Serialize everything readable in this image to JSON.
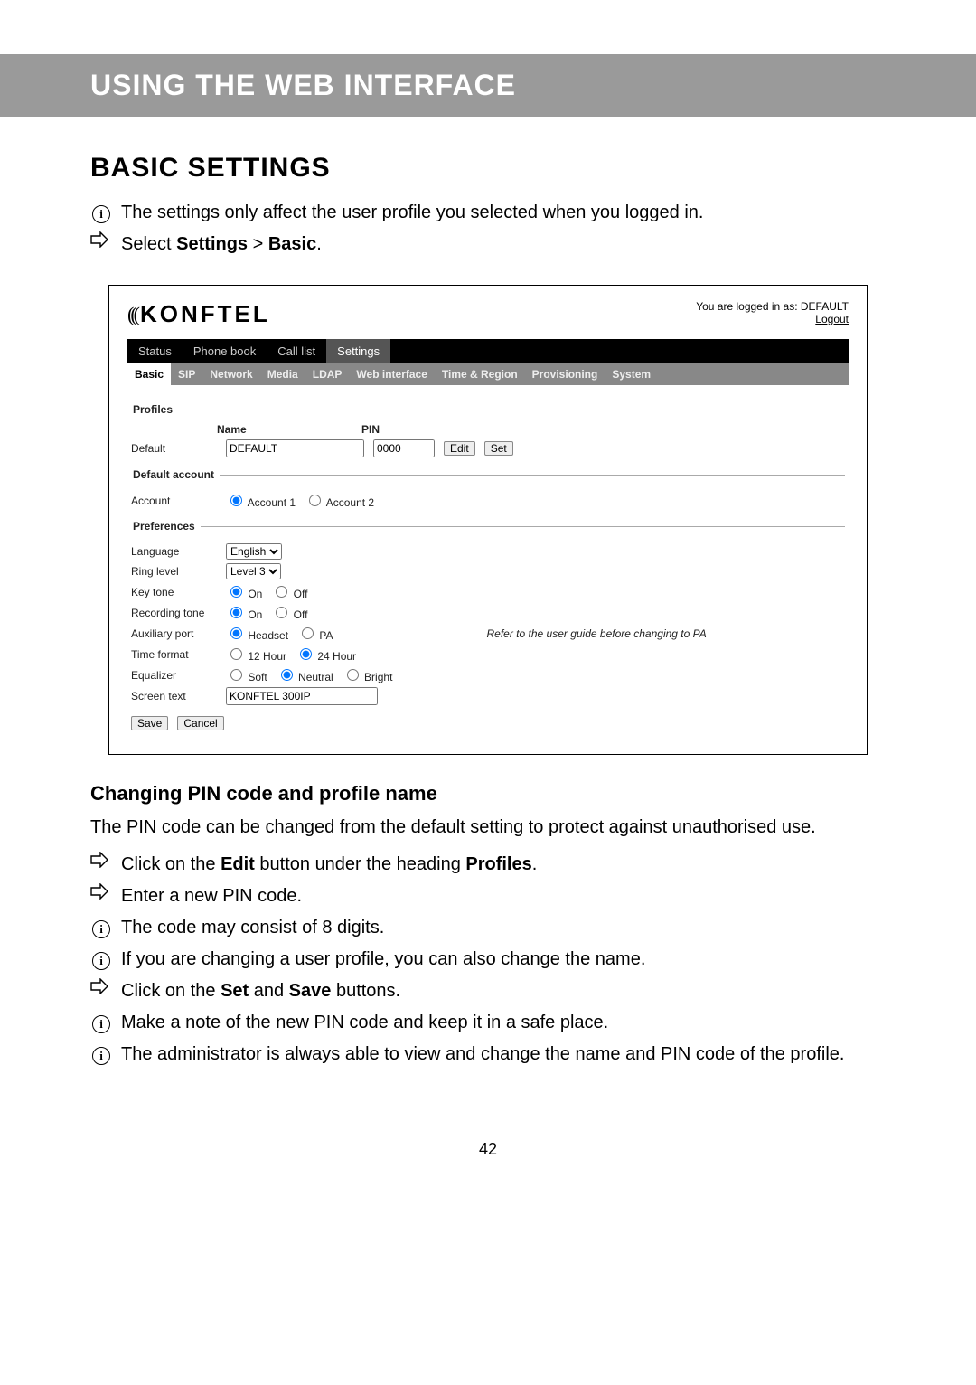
{
  "banner": "USING THE WEB INTERFACE",
  "section_title": "BASIC SETTINGS",
  "intro_info": "The settings only affect the user profile you selected when you logged in.",
  "intro_arrow_prefix": "Select ",
  "intro_arrow_bold1": "Settings",
  "intro_arrow_sep": " > ",
  "intro_arrow_bold2": "Basic",
  "intro_arrow_suffix": ".",
  "logo": "KONFTEL",
  "logged_in_prefix": "You are logged in as: ",
  "logged_in_user": "DEFAULT",
  "logout": "Logout",
  "main_tabs": [
    "Status",
    "Phone book",
    "Call list",
    "Settings"
  ],
  "main_tabs_active_index": 3,
  "sub_tabs": [
    "Basic",
    "SIP",
    "Network",
    "Media",
    "LDAP",
    "Web interface",
    "Time & Region",
    "Provisioning",
    "System"
  ],
  "sub_tabs_active_index": 0,
  "legend_profiles": "Profiles",
  "legend_default_account": "Default account",
  "legend_preferences": "Preferences",
  "hdr_name": "Name",
  "hdr_pin": "PIN",
  "row_default_label": "Default",
  "field_name_value": "DEFAULT",
  "field_pin_value": "0000",
  "btn_edit": "Edit",
  "btn_set": "Set",
  "row_account_label": "Account",
  "account_options": [
    "Account 1",
    "Account 2"
  ],
  "row_language_label": "Language",
  "language_value": "English",
  "row_ring_label": "Ring level",
  "ring_value": "Level 3",
  "row_keytone_label": "Key tone",
  "onoff": [
    "On",
    "Off"
  ],
  "row_rectone_label": "Recording tone",
  "row_aux_label": "Auxiliary port",
  "aux_options": [
    "Headset",
    "PA"
  ],
  "aux_note": "Refer to the user guide before changing to PA",
  "row_timefmt_label": "Time format",
  "timefmt_options": [
    "12 Hour",
    "24 Hour"
  ],
  "row_eq_label": "Equalizer",
  "eq_options": [
    "Soft",
    "Neutral",
    "Bright"
  ],
  "row_screen_label": "Screen text",
  "screen_value": "KONFTEL 300IP",
  "btn_save": "Save",
  "btn_cancel": "Cancel",
  "sub_heading": "Changing PIN code and profile name",
  "sub_body": "The PIN code can be changed from the default setting to protect against unauthorised use.",
  "step1_pre": "Click on the ",
  "step1_b1": "Edit",
  "step1_mid": " button under the heading ",
  "step1_b2": "Profiles",
  "step1_post": ".",
  "step2": "Enter a new PIN code.",
  "note1": "The code may consist of 8 digits.",
  "note2": "If you are changing a user profile, you can also change the name.",
  "step3_pre": "Click on the ",
  "step3_b1": "Set",
  "step3_mid": " and ",
  "step3_b2": "Save",
  "step3_post": " buttons.",
  "note3": "Make a note of the new PIN code and keep it in a safe place.",
  "note4": "The administrator is always able to view and change the name and PIN code of the profile.",
  "page_number": "42"
}
